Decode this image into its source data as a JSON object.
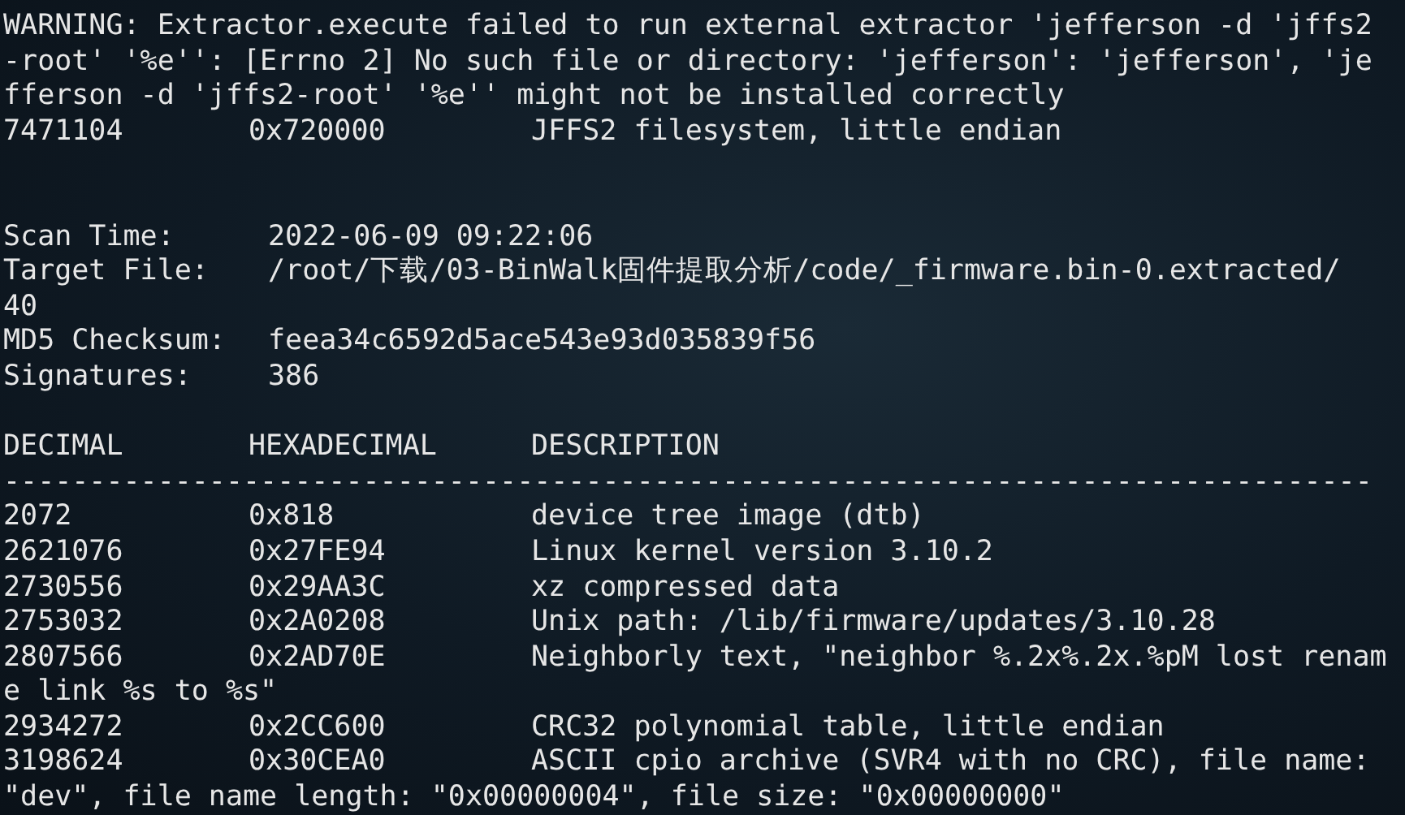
{
  "terminal": {
    "lines": [
      {
        "kind": "text",
        "text": "WARNING: Extractor.execute failed to run external extractor 'jefferson -d 'jffs2"
      },
      {
        "kind": "text",
        "text": "-root' '%e'': [Errno 2] No such file or directory: 'jefferson': 'jefferson', 'je"
      },
      {
        "kind": "text",
        "text": "fferson -d 'jffs2-root' '%e'' might not be installed correctly"
      },
      {
        "kind": "row",
        "cells": [
          "7471104",
          "0x720000",
          "JFFS2 filesystem, little endian"
        ]
      },
      {
        "kind": "blank"
      },
      {
        "kind": "blank"
      },
      {
        "kind": "field",
        "label": "Scan Time:",
        "value": "2022-06-09 09:22:06"
      },
      {
        "kind": "field",
        "label": "Target File:",
        "value": "/root/下载/03-BinWalk固件提取分析/code/_firmware.bin-0.extracted/"
      },
      {
        "kind": "text",
        "text": "40"
      },
      {
        "kind": "field",
        "label": "MD5 Checksum:",
        "value": "feea34c6592d5ace543e93d035839f56"
      },
      {
        "kind": "field",
        "label": "Signatures:",
        "value": "386"
      },
      {
        "kind": "blank"
      },
      {
        "kind": "header",
        "cells": [
          "DECIMAL",
          "HEXADECIMAL",
          "DESCRIPTION"
        ]
      },
      {
        "kind": "text",
        "text": "--------------------------------------------------------------------------------"
      },
      {
        "kind": "row",
        "cells": [
          "2072",
          "0x818",
          "device tree image (dtb)"
        ]
      },
      {
        "kind": "row",
        "cells": [
          "2621076",
          "0x27FE94",
          "Linux kernel version 3.10.2"
        ]
      },
      {
        "kind": "row",
        "cells": [
          "2730556",
          "0x29AA3C",
          "xz compressed data"
        ]
      },
      {
        "kind": "row",
        "cells": [
          "2753032",
          "0x2A0208",
          "Unix path: /lib/firmware/updates/3.10.28"
        ]
      },
      {
        "kind": "row",
        "cells": [
          "2807566",
          "0x2AD70E",
          "Neighborly text, \"neighbor %.2x%.2x.%pM lost renam"
        ]
      },
      {
        "kind": "text",
        "text": "e link %s to %s\""
      },
      {
        "kind": "row",
        "cells": [
          "2934272",
          "0x2CC600",
          "CRC32 polynomial table, little endian"
        ]
      },
      {
        "kind": "row",
        "cells": [
          "3198624",
          "0x30CEA0",
          "ASCII cpio archive (SVR4 with no CRC), file name:"
        ]
      },
      {
        "kind": "text",
        "text": "\"dev\", file name length: \"0x00000004\", file size: \"0x00000000\""
      }
    ]
  }
}
